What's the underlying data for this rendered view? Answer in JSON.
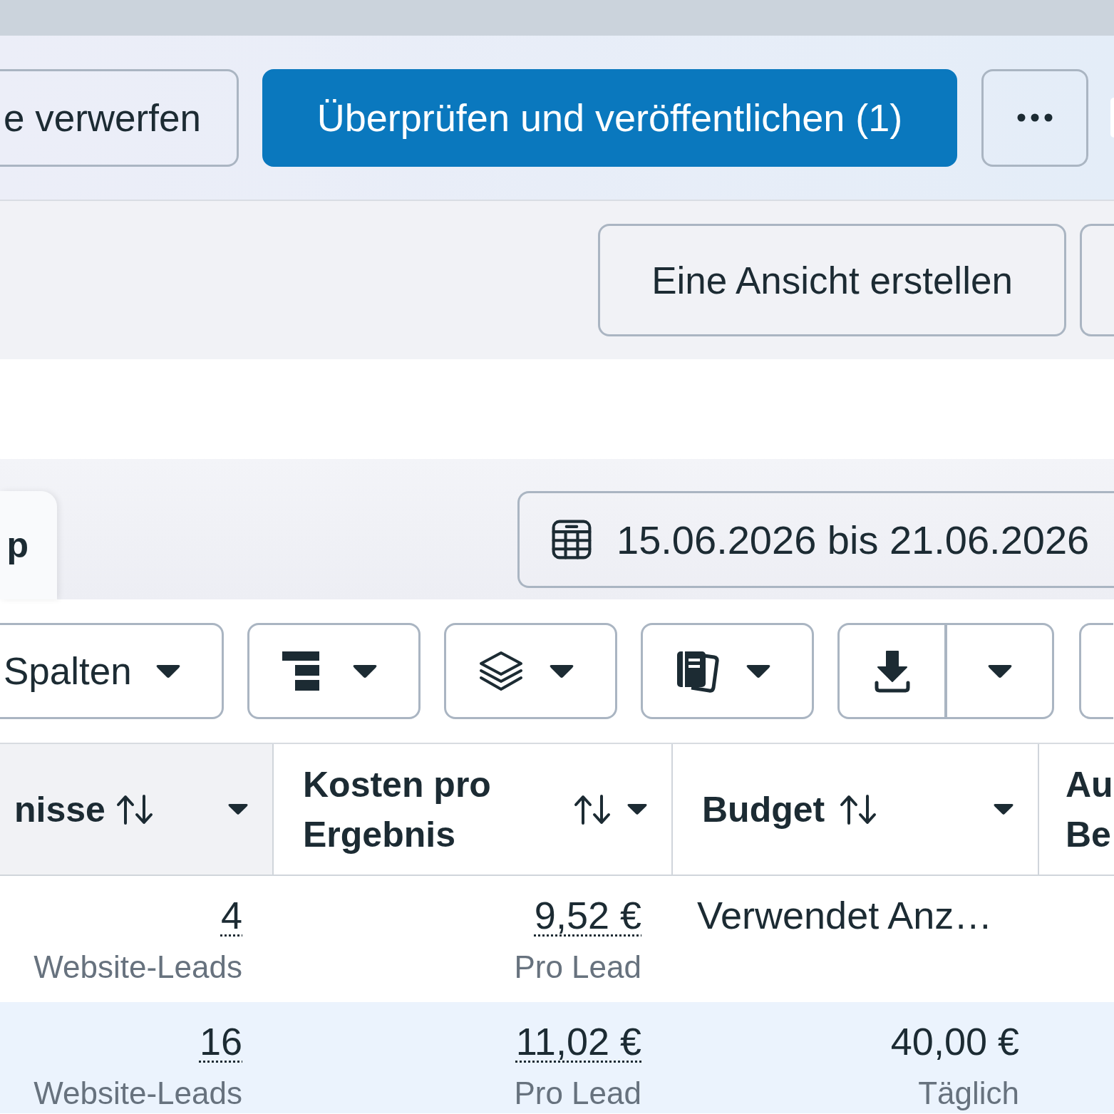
{
  "actions": {
    "discard": "e verwerfen",
    "publish": "Überprüfen und veröffentlichen (1)"
  },
  "view_bar": {
    "create_view": "Eine Ansicht erstellen"
  },
  "tabs": [
    {
      "label": "p",
      "selected": true
    }
  ],
  "date_range": "15.06.2026 bis 21.06.2026",
  "toolbar": {
    "columns": "Spalten"
  },
  "table": {
    "columns": [
      {
        "label": "nisse",
        "highlighted": true,
        "sortable": true
      },
      {
        "label": "Kosten pro Ergebnis",
        "highlighted": false,
        "sortable": true
      },
      {
        "label": "Budget",
        "highlighted": false,
        "sortable": true
      },
      {
        "label": "Au Be",
        "highlighted": false,
        "sortable": false
      }
    ],
    "rows": [
      {
        "selected": false,
        "cells": [
          {
            "kind": "metric",
            "value": "4",
            "caption": "Website-Leads"
          },
          {
            "kind": "metric",
            "value": "9,52 €",
            "caption": "Pro Lead"
          },
          {
            "kind": "note",
            "value": "Verwendet Anz…"
          }
        ]
      },
      {
        "selected": true,
        "cells": [
          {
            "kind": "metric",
            "value": "16",
            "caption": "Website-Leads"
          },
          {
            "kind": "metric",
            "value": "11,02 €",
            "caption": "Pro Lead"
          },
          {
            "kind": "amount",
            "value": "40,00 €",
            "caption": "Täglich"
          }
        ]
      }
    ]
  }
}
